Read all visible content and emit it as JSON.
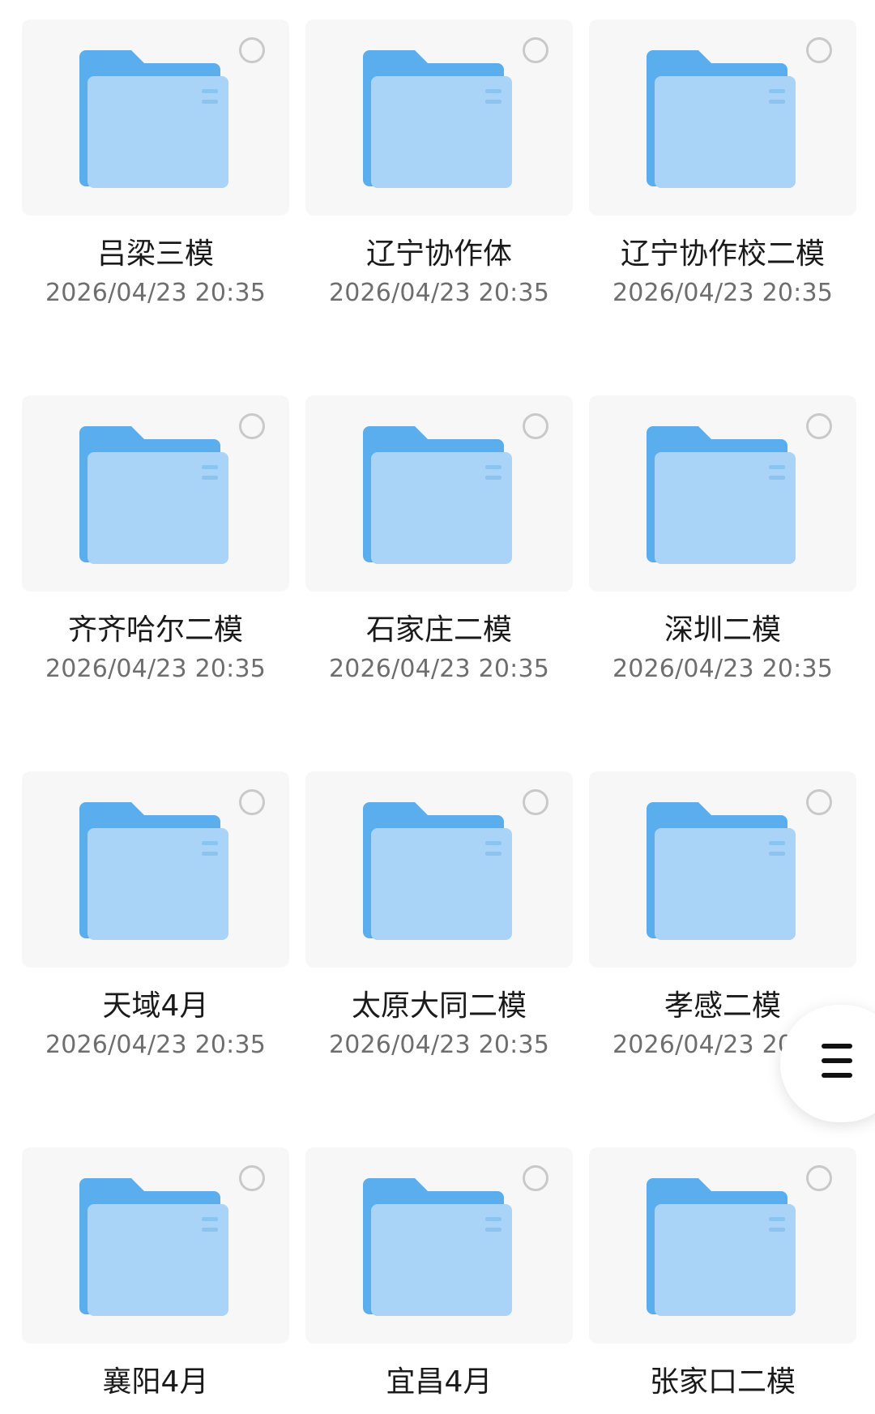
{
  "folders": [
    {
      "name": "吕梁三模",
      "date": "2026/04/23 20:35"
    },
    {
      "name": "辽宁协作体",
      "date": "2026/04/23 20:35"
    },
    {
      "name": "辽宁协作校二模",
      "date": "2026/04/23 20:35"
    },
    {
      "name": "齐齐哈尔二模",
      "date": "2026/04/23 20:35"
    },
    {
      "name": "石家庄二模",
      "date": "2026/04/23 20:35"
    },
    {
      "name": "深圳二模",
      "date": "2026/04/23 20:35"
    },
    {
      "name": "天域4月",
      "date": "2026/04/23 20:35"
    },
    {
      "name": "太原大同二模",
      "date": "2026/04/23 20:35"
    },
    {
      "name": "孝感二模",
      "date": "2026/04/23 20:35"
    },
    {
      "name": "襄阳4月",
      "date": ""
    },
    {
      "name": "宜昌4月",
      "date": ""
    },
    {
      "name": "张家口二模",
      "date": ""
    }
  ],
  "icons": {
    "folder": "folder-icon",
    "select": "select-radio-icon",
    "menu": "menu-icon"
  },
  "colors": {
    "folder_back": "#5aaeee",
    "folder_front": "#a9d4f8",
    "card_bg": "#f7f7f7",
    "radio_border": "#c9c9c9",
    "name_text": "#1a1a1a",
    "date_text": "#6e6e6e"
  }
}
